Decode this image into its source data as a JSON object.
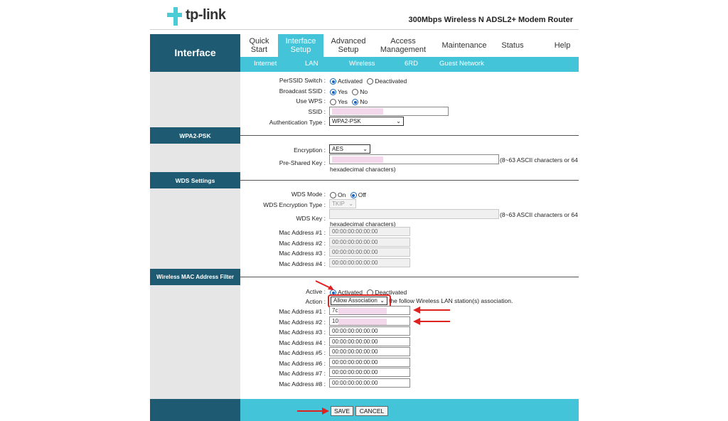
{
  "header": {
    "brand": "tp-link",
    "product": "300Mbps Wireless N ADSL2+ Modem Router"
  },
  "nav": {
    "section_title": "Interface",
    "tabs": [
      {
        "label": "Quick Start"
      },
      {
        "label": "Interface Setup",
        "active": true
      },
      {
        "label": "Advanced Setup"
      },
      {
        "label": "Access Management"
      },
      {
        "label": "Maintenance"
      },
      {
        "label": "Status"
      },
      {
        "label": "Help"
      }
    ],
    "subtabs": [
      "Internet",
      "LAN",
      "Wireless",
      "6RD",
      "Guest Network"
    ]
  },
  "ssid_section": {
    "perssid_label": "PerSSID Switch :",
    "perssid_options": [
      "Activated",
      "Deactivated"
    ],
    "perssid_selected": "Activated",
    "broadcast_label": "Broadcast SSID :",
    "broadcast_options": [
      "Yes",
      "No"
    ],
    "broadcast_selected": "Yes",
    "wps_label": "Use WPS :",
    "wps_options": [
      "Yes",
      "No"
    ],
    "wps_selected": "No",
    "ssid_label": "SSID :",
    "auth_label": "Authentication Type :",
    "auth_value": "WPA2-PSK"
  },
  "wpa2": {
    "title": "WPA2-PSK",
    "encryption_label": "Encryption :",
    "encryption_value": "AES",
    "psk_label": "Pre-Shared Key :",
    "psk_note1": "(8~63 ASCII characters or 64",
    "psk_note2": "hexadecimal characters)"
  },
  "wds": {
    "title": "WDS Settings",
    "mode_label": "WDS Mode :",
    "mode_options": [
      "On",
      "Off"
    ],
    "mode_selected": "Off",
    "enc_label": "WDS Encryption Type :",
    "enc_value": "TKIP",
    "key_label": "WDS Key :",
    "key_note1": "(8~63 ASCII characters or 64",
    "key_note2": "hexadecimal characters)",
    "macs": [
      {
        "label": "Mac Address #1 :",
        "value": "00:00:00:00:00:00"
      },
      {
        "label": "Mac Address #2 :",
        "value": "00:00:00:00:00:00"
      },
      {
        "label": "Mac Address #3 :",
        "value": "00:00:00:00:00:00"
      },
      {
        "label": "Mac Address #4 :",
        "value": "00:00:00:00:00:00"
      }
    ]
  },
  "macfilter": {
    "title": "Wireless MAC Address Filter",
    "active_label": "Active :",
    "active_options": [
      "Activated",
      "Deactivated"
    ],
    "active_selected": "Activated",
    "action_label": "Action :",
    "action_value": "Allow Association",
    "action_suffix": "the follow Wireless LAN station(s) association.",
    "macs": [
      {
        "label": "Mac Address #1 :",
        "value": "7c:"
      },
      {
        "label": "Mac Address #2 :",
        "value": "10:"
      },
      {
        "label": "Mac Address #3 :",
        "value": "00:00:00:00:00:00"
      },
      {
        "label": "Mac Address #4 :",
        "value": "00:00:00:00:00:00"
      },
      {
        "label": "Mac Address #5 :",
        "value": "00:00:00:00:00:00"
      },
      {
        "label": "Mac Address #6 :",
        "value": "00:00:00:00:00:00"
      },
      {
        "label": "Mac Address #7 :",
        "value": "00:00:00:00:00:00"
      },
      {
        "label": "Mac Address #8 :",
        "value": "00:00:00:00:00:00"
      }
    ]
  },
  "footer": {
    "save_label": "SAVE",
    "cancel_label": "CANCEL"
  },
  "colors": {
    "dark_teal": "#1e5b73",
    "cyan": "#44c4d8",
    "annotation_red": "#d22222",
    "redacted_pink": "#f2d8ea"
  }
}
